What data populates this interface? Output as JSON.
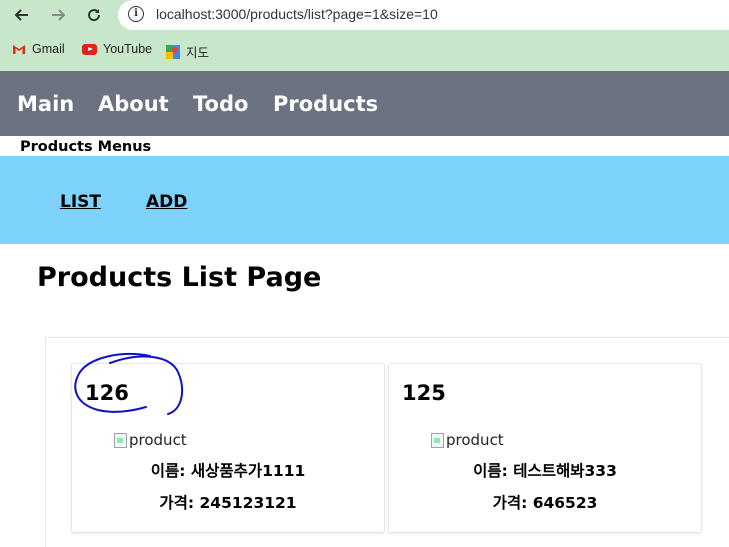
{
  "browser": {
    "url": "localhost:3000/products/list?page=1&size=10",
    "bookmarks": [
      {
        "label": "Gmail",
        "icon": "gmail-icon"
      },
      {
        "label": "YouTube",
        "icon": "youtube-icon"
      },
      {
        "label": "지도",
        "icon": "maps-icon"
      }
    ]
  },
  "nav": {
    "items": [
      "Main",
      "About",
      "Todo",
      "Products"
    ]
  },
  "products_menu": {
    "title": "Products Menus",
    "list_label": "LIST",
    "add_label": "ADD"
  },
  "page": {
    "title": "Products List Page"
  },
  "products": [
    {
      "pno": "126",
      "img_alt": "product",
      "name_text": "이름: 새상품추가1111",
      "price_text": "가격: 245123121"
    },
    {
      "pno": "125",
      "img_alt": "product",
      "name_text": "이름: 테스트해봐333",
      "price_text": "가격: 646523"
    }
  ],
  "colors": {
    "browser_chrome": "#c8e6c9",
    "nav_bg": "#6b7280",
    "submenu_bg": "#7dd3fc",
    "annotation_stroke": "#1010c8"
  }
}
